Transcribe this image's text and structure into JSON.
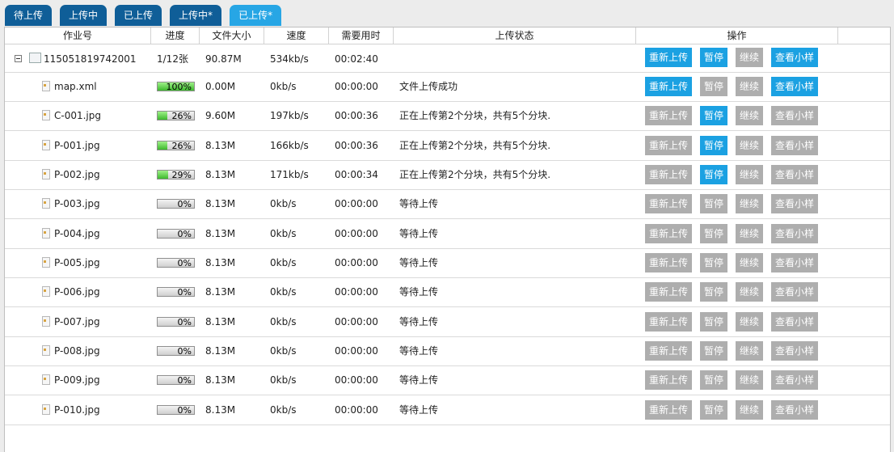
{
  "tabs": [
    {
      "label": "待上传",
      "active": false
    },
    {
      "label": "上传中",
      "active": false
    },
    {
      "label": "已上传",
      "active": false
    },
    {
      "label": "上传中*",
      "active": false
    },
    {
      "label": "已上传*",
      "active": true
    }
  ],
  "columns": {
    "job_no": "作业号",
    "progress": "进度",
    "size": "文件大小",
    "speed": "速度",
    "time": "需要用时",
    "status": "上传状态",
    "actions": "操作"
  },
  "actions": {
    "reupload": "重新上传",
    "pause": "暂停",
    "resume": "继续",
    "preview": "查看小样"
  },
  "job": {
    "job_no": "115051819742001",
    "progress": "1/12张",
    "size": "90.87M",
    "speed": "534kb/s",
    "time": "00:02:40",
    "status": "",
    "buttons": {
      "reupload": true,
      "pause": true,
      "resume": false,
      "preview": true
    }
  },
  "files": [
    {
      "name": "map.xml",
      "percent": 100,
      "percent_label": "100%",
      "size": "0.00M",
      "speed": "0kb/s",
      "time": "00:00:00",
      "status": "文件上传成功",
      "buttons": {
        "reupload": true,
        "pause": false,
        "resume": false,
        "preview": true
      }
    },
    {
      "name": "C-001.jpg",
      "percent": 26,
      "percent_label": "26%",
      "size": "9.60M",
      "speed": "197kb/s",
      "time": "00:00:36",
      "status": "正在上传第2个分块，共有5个分块.",
      "buttons": {
        "reupload": false,
        "pause": true,
        "resume": false,
        "preview": false
      }
    },
    {
      "name": "P-001.jpg",
      "percent": 26,
      "percent_label": "26%",
      "size": "8.13M",
      "speed": "166kb/s",
      "time": "00:00:36",
      "status": "正在上传第2个分块，共有5个分块.",
      "buttons": {
        "reupload": false,
        "pause": true,
        "resume": false,
        "preview": false
      }
    },
    {
      "name": "P-002.jpg",
      "percent": 29,
      "percent_label": "29%",
      "size": "8.13M",
      "speed": "171kb/s",
      "time": "00:00:34",
      "status": "正在上传第2个分块，共有5个分块.",
      "buttons": {
        "reupload": false,
        "pause": true,
        "resume": false,
        "preview": false
      }
    },
    {
      "name": "P-003.jpg",
      "percent": 0,
      "percent_label": "0%",
      "size": "8.13M",
      "speed": "0kb/s",
      "time": "00:00:00",
      "status": "等待上传",
      "buttons": {
        "reupload": false,
        "pause": false,
        "resume": false,
        "preview": false
      }
    },
    {
      "name": "P-004.jpg",
      "percent": 0,
      "percent_label": "0%",
      "size": "8.13M",
      "speed": "0kb/s",
      "time": "00:00:00",
      "status": "等待上传",
      "buttons": {
        "reupload": false,
        "pause": false,
        "resume": false,
        "preview": false
      }
    },
    {
      "name": "P-005.jpg",
      "percent": 0,
      "percent_label": "0%",
      "size": "8.13M",
      "speed": "0kb/s",
      "time": "00:00:00",
      "status": "等待上传",
      "buttons": {
        "reupload": false,
        "pause": false,
        "resume": false,
        "preview": false
      }
    },
    {
      "name": "P-006.jpg",
      "percent": 0,
      "percent_label": "0%",
      "size": "8.13M",
      "speed": "0kb/s",
      "time": "00:00:00",
      "status": "等待上传",
      "buttons": {
        "reupload": false,
        "pause": false,
        "resume": false,
        "preview": false
      }
    },
    {
      "name": "P-007.jpg",
      "percent": 0,
      "percent_label": "0%",
      "size": "8.13M",
      "speed": "0kb/s",
      "time": "00:00:00",
      "status": "等待上传",
      "buttons": {
        "reupload": false,
        "pause": false,
        "resume": false,
        "preview": false
      }
    },
    {
      "name": "P-008.jpg",
      "percent": 0,
      "percent_label": "0%",
      "size": "8.13M",
      "speed": "0kb/s",
      "time": "00:00:00",
      "status": "等待上传",
      "buttons": {
        "reupload": false,
        "pause": false,
        "resume": false,
        "preview": false
      }
    },
    {
      "name": "P-009.jpg",
      "percent": 0,
      "percent_label": "0%",
      "size": "8.13M",
      "speed": "0kb/s",
      "time": "00:00:00",
      "status": "等待上传",
      "buttons": {
        "reupload": false,
        "pause": false,
        "resume": false,
        "preview": false
      }
    },
    {
      "name": "P-010.jpg",
      "percent": 0,
      "percent_label": "0%",
      "size": "8.13M",
      "speed": "0kb/s",
      "time": "00:00:00",
      "status": "等待上传",
      "buttons": {
        "reupload": false,
        "pause": false,
        "resume": false,
        "preview": false
      }
    }
  ],
  "colors": {
    "tab_default": "#0f5e98",
    "tab_active": "#27a6e5",
    "button_enabled": "#1ba1e2",
    "button_disabled": "#aeaeae",
    "progress_fill": "#3db92d"
  }
}
